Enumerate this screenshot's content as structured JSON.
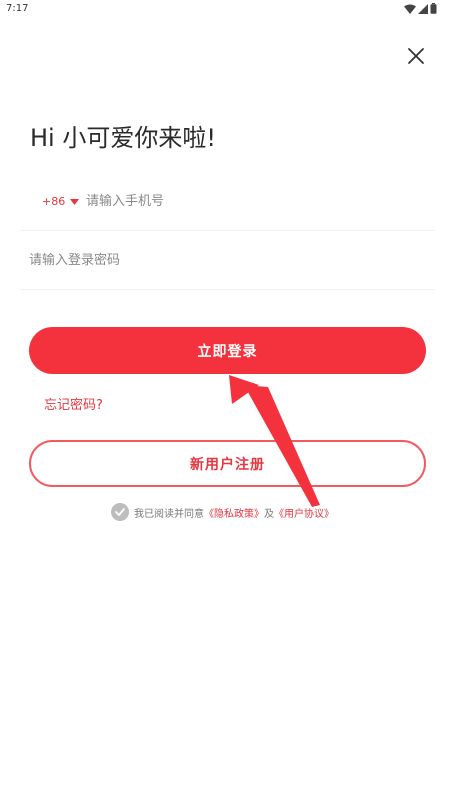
{
  "status_bar": {
    "time": "7:17",
    "icons": [
      "wifi-icon",
      "signal-icon",
      "battery-icon"
    ]
  },
  "close_icon": "close-icon",
  "greeting": "Hi 小可爱你来啦!",
  "phone": {
    "country_code": "+86",
    "placeholder": "请输入手机号",
    "value": ""
  },
  "password": {
    "placeholder": "请输入登录密码",
    "value": ""
  },
  "buttons": {
    "login": "立即登录",
    "register": "新用户注册"
  },
  "forgot_password": "忘记密码?",
  "agreement": {
    "prefix": "我已阅读并同意",
    "privacy": "《隐私政策》",
    "conjunction": "及",
    "terms": "《用户协议》",
    "checked": true
  },
  "colors": {
    "accent": "#f4323d",
    "accent_text": "#e6363f",
    "border_light": "#f1f1f1",
    "check_grey": "#bdbdbd"
  }
}
